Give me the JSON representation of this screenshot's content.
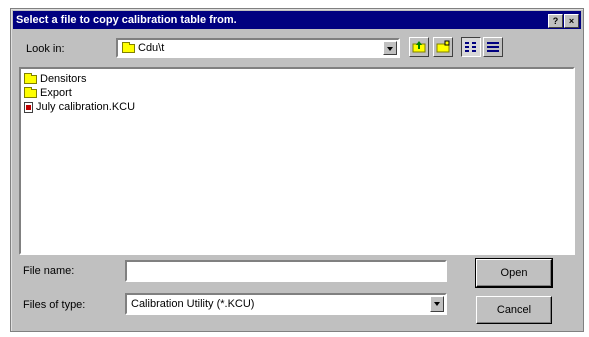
{
  "dialog": {
    "title": "Select a file to copy calibration table from.",
    "help_label": "?",
    "close_label": "×"
  },
  "look_in": {
    "label": "Look in:",
    "value": "Cdu\\t"
  },
  "toolbar": {
    "icons": [
      "up-one-level-icon",
      "create-new-folder-icon",
      "list-view-icon",
      "details-view-icon"
    ]
  },
  "files": [
    {
      "name": "Densitors",
      "type": "folder"
    },
    {
      "name": "Export",
      "type": "folder"
    },
    {
      "name": "July calibration.KCU",
      "type": "file"
    }
  ],
  "file_name": {
    "label": "File name:",
    "value": ""
  },
  "file_type": {
    "label": "Files of type:",
    "value": "Calibration Utility (*.KCU)"
  },
  "buttons": {
    "open": "Open",
    "cancel": "Cancel"
  }
}
